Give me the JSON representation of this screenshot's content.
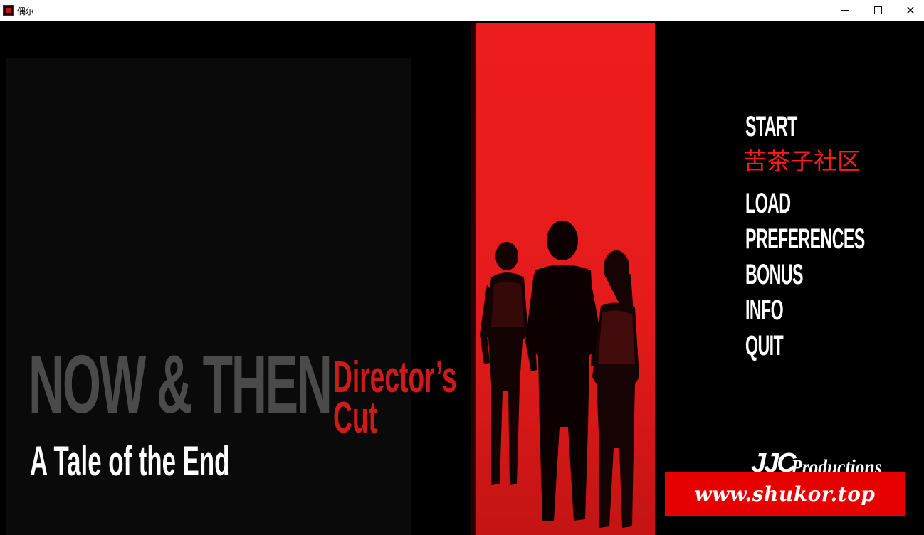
{
  "window": {
    "title": "偶尔",
    "minimize_glyph": "—",
    "maximize_glyph": "☐",
    "close_glyph": "✕"
  },
  "game": {
    "title_main": "NOW & THEN",
    "title_edition_line1": "Director’s",
    "title_edition_line2": "Cut",
    "subtitle": "A Tale of the End",
    "colors": {
      "accent_red": "#e51b1b",
      "title_gray": "#4a4a4a",
      "menu_white": "#ffffff",
      "menu_cn_red": "#ff1a1a"
    }
  },
  "menu": {
    "start": "START",
    "community": "苦茶子社区",
    "load": "LOAD",
    "preferences": "PREFERENCES",
    "bonus": "BONUS",
    "info": "INFO",
    "quit": "QUIT"
  },
  "studio": {
    "mark": "JJC",
    "name": "Productions"
  },
  "watermark": {
    "text": "www.shukor.top"
  }
}
